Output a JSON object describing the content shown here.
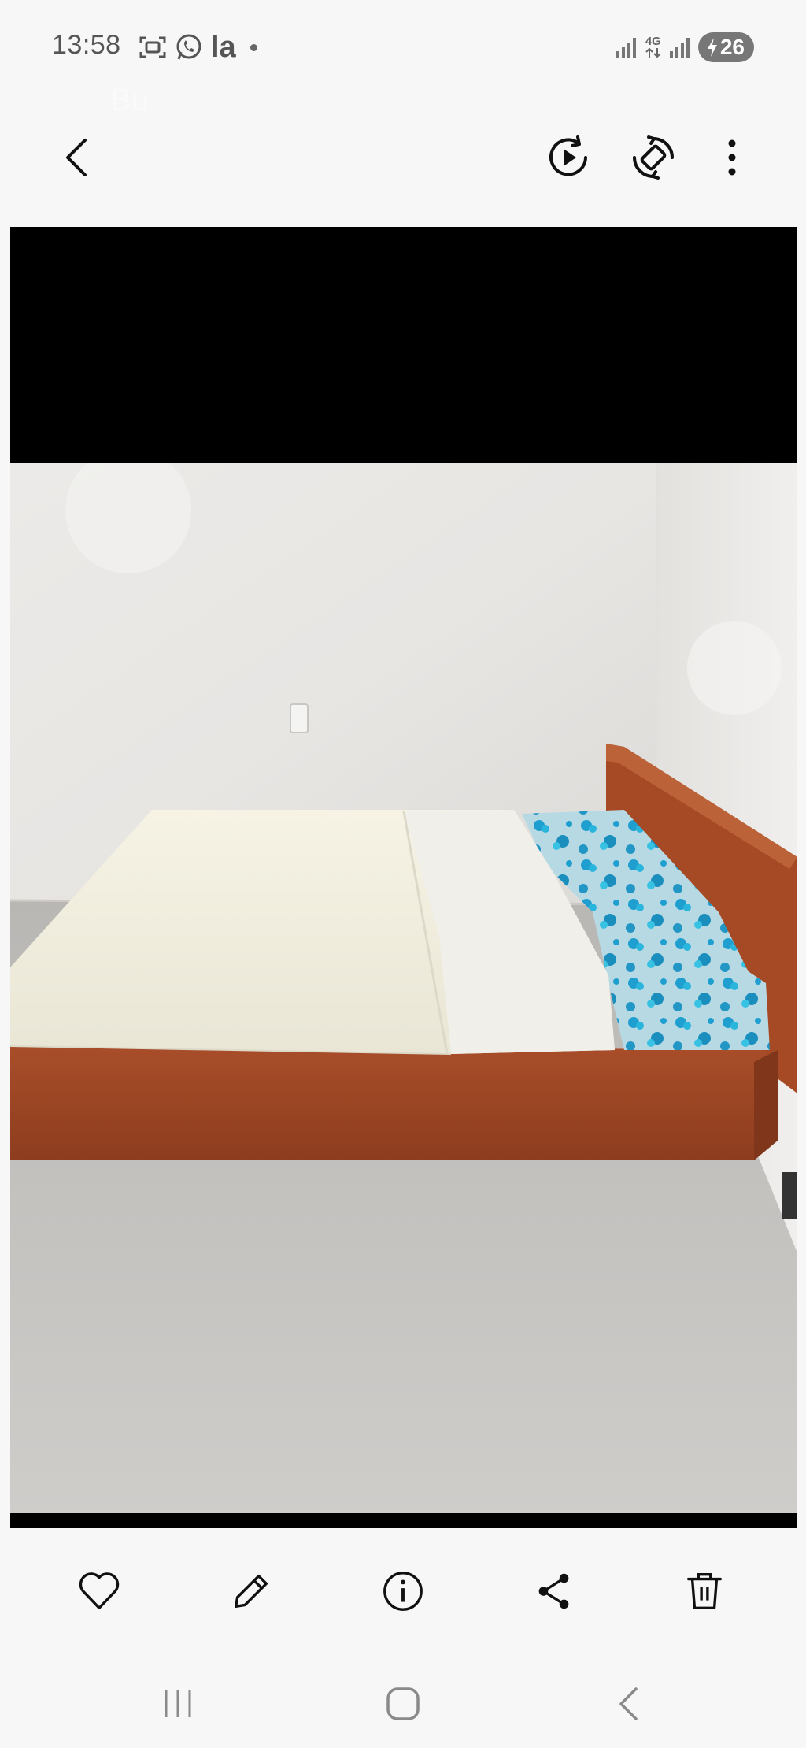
{
  "status_bar": {
    "time": "13:58",
    "app_indicator": "la",
    "network": "4G",
    "battery": "26"
  },
  "top_bar": {
    "title": "Bu"
  },
  "photo": {
    "description_icon": "bed-photo"
  }
}
